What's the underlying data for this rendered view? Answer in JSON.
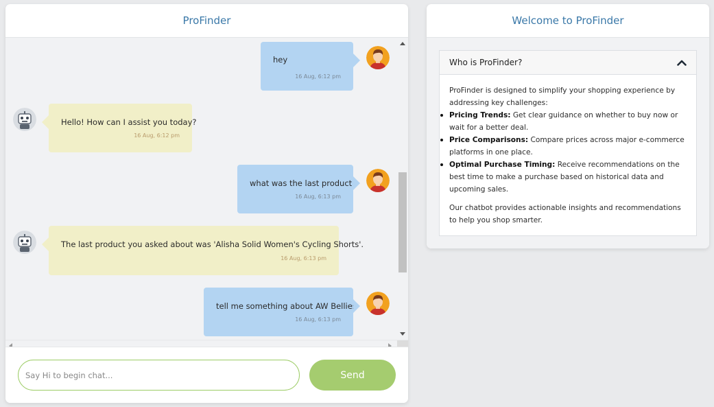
{
  "chat": {
    "title": "ProFinder",
    "messages": [
      {
        "role": "user",
        "text": "hey",
        "time": "16 Aug, 6:12 pm"
      },
      {
        "role": "bot",
        "text": "Hello! How can I assist you today?",
        "time": "16 Aug, 6:12 pm"
      },
      {
        "role": "user",
        "text": "what was the last product",
        "time": "16 Aug, 6:13 pm"
      },
      {
        "role": "bot",
        "text": "The last product you asked about was 'Alisha Solid Women's Cycling Shorts'.",
        "time": "16 Aug, 6:13 pm"
      },
      {
        "role": "user",
        "text": "tell me something about AW Bellies",
        "time": "16 Aug, 6:13 pm"
      }
    ],
    "input_placeholder": "Say Hi to begin chat...",
    "input_value": "",
    "send_label": "Send",
    "colors": {
      "user_bubble": "#b3d4f2",
      "bot_bubble": "#f1efc8",
      "send_button": "#a5cc6f",
      "header_title": "#3a78a8"
    }
  },
  "welcome": {
    "title": "Welcome to ProFinder",
    "accordion": {
      "question": "Who is ProFinder?",
      "expanded": true,
      "intro": "ProFinder is designed to simplify your shopping experience by addressing key challenges:",
      "points": [
        {
          "term": "Pricing Trends:",
          "desc": " Get clear guidance on whether to buy now or wait for a better deal."
        },
        {
          "term": "Price Comparisons:",
          "desc": " Compare prices across major e-commerce platforms in one place."
        },
        {
          "term": "Optimal Purchase Timing:",
          "desc": " Receive recommendations on the best time to make a purchase based on historical data and upcoming sales."
        }
      ],
      "outro": "Our chatbot provides actionable insights and recommendations to help you shop smarter."
    }
  }
}
